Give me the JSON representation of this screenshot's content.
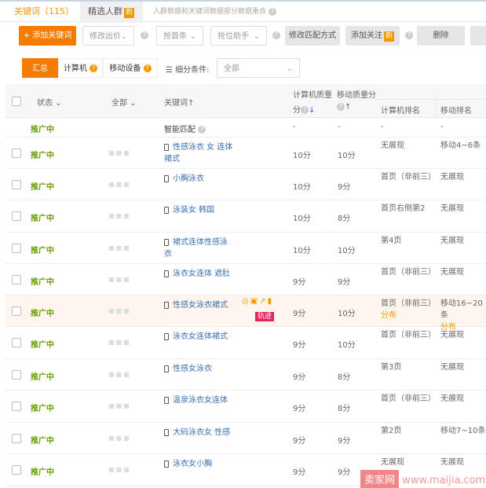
{
  "tabs": [
    {
      "label": "关键词（115）",
      "active": true
    },
    {
      "label": "精选人群",
      "badge": "新"
    }
  ],
  "tab_note": "人群数据和关键词数据部分数据重合",
  "toolbar": {
    "add": "+ 添加关键词",
    "bid": "修改出价",
    "first": "抢首条",
    "helper": "抢位助手",
    "match": "修改匹配方式",
    "follow": "添加关注",
    "follow_badge": "新",
    "delete": "删除"
  },
  "segments": {
    "summary": "汇总",
    "pc": "计算机",
    "mobile": "移动设备",
    "filter_label": "细分条件:",
    "filter_value": "全部"
  },
  "header": {
    "status": "状态",
    "all": "全部",
    "keyword": "关键词",
    "pc_q1": "计算机质量",
    "pc_q2": "分",
    "mob_q": "移动质量分",
    "pc_rank": "计算机排名",
    "mob_rank": "移动排名"
  },
  "smart": {
    "status": "推广中",
    "keyword": "智能匹配",
    "pc_q": "-",
    "mob_q": "-",
    "pc_rank": "-",
    "mob_rank": "-"
  },
  "rows": [
    {
      "status": "推广中",
      "keyword": "性感泳衣 女 连体 裙式",
      "pc_q": "10分",
      "mob_q": "10分",
      "pc_rank": "无展现",
      "mob_rank": "移动4~6条"
    },
    {
      "status": "推广中",
      "keyword": "小胸泳衣",
      "pc_q": "10分",
      "mob_q": "9分",
      "pc_rank": "首页（非前三）",
      "mob_rank": "无展现"
    },
    {
      "status": "推广中",
      "keyword": "泳装女 韩国",
      "pc_q": "10分",
      "mob_q": "8分",
      "pc_rank": "首页右侧第2",
      "mob_rank": "无展现"
    },
    {
      "status": "推广中",
      "keyword": "裙式连体性感泳衣",
      "pc_q": "10分",
      "mob_q": "10分",
      "pc_rank": "第4页",
      "mob_rank": "无展现"
    },
    {
      "status": "推广中",
      "keyword": "泳衣女连体 遮肚",
      "pc_q": "9分",
      "mob_q": "9分",
      "pc_rank": "首页（非前三）",
      "mob_rank": "无展现"
    },
    {
      "status": "推广中",
      "keyword": "性感女泳衣裙式",
      "pc_q": "9分",
      "mob_q": "10分",
      "pc_rank": "首页（非前三）",
      "mob_rank": "移动16~20条",
      "pc_sub": "分布",
      "mob_sub": "分布",
      "badge": "轨迹",
      "highlight": true
    },
    {
      "status": "推广中",
      "keyword": "泳衣女连体裙式",
      "pc_q": "9分",
      "mob_q": "10分",
      "pc_rank": "首页（非前三）",
      "mob_rank": "无展现"
    },
    {
      "status": "推广中",
      "keyword": "性感女泳衣",
      "pc_q": "9分",
      "mob_q": "8分",
      "pc_rank": "第3页",
      "mob_rank": "无展现"
    },
    {
      "status": "推广中",
      "keyword": "温泉泳衣女连体",
      "pc_q": "9分",
      "mob_q": "8分",
      "pc_rank": "首页（非前三）",
      "mob_rank": "无展现"
    },
    {
      "status": "推广中",
      "keyword": "大码泳衣女 性感",
      "pc_q": "9分",
      "mob_q": "9分",
      "pc_rank": "第2页",
      "mob_rank": "移动7~10条"
    },
    {
      "status": "推广中",
      "keyword": "泳衣女小胸",
      "pc_q": "9分",
      "mob_q": "9分",
      "pc_rank": "无展现",
      "mob_rank": "无展现"
    }
  ],
  "watermark": {
    "brand": "卖家网",
    "url": "www.maijia.com"
  },
  "colors": {
    "accent": "#f39800",
    "status": "#6a9e0c",
    "link": "#3a6fb5"
  }
}
